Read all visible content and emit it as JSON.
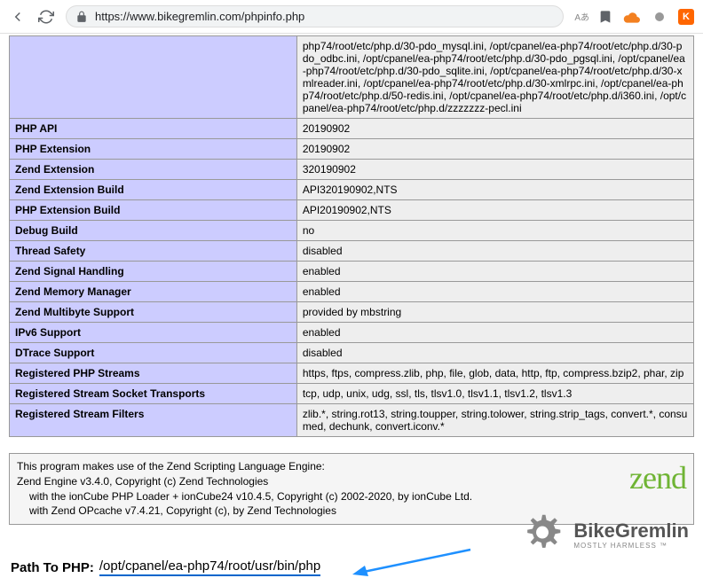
{
  "browser": {
    "url": "https://www.bikegremlin.com/phpinfo.php",
    "translate_label": "Aあ"
  },
  "php_rows": [
    {
      "label": "",
      "value": "php74/root/etc/php.d/30-pdo_mysql.ini, /opt/cpanel/ea-php74/root/etc/php.d/30-pdo_odbc.ini, /opt/cpanel/ea-php74/root/etc/php.d/30-pdo_pgsql.ini, /opt/cpanel/ea-php74/root/etc/php.d/30-pdo_sqlite.ini, /opt/cpanel/ea-php74/root/etc/php.d/30-xmlreader.ini, /opt/cpanel/ea-php74/root/etc/php.d/30-xmlrpc.ini, /opt/cpanel/ea-php74/root/etc/php.d/50-redis.ini, /opt/cpanel/ea-php74/root/etc/php.d/i360.ini, /opt/cpanel/ea-php74/root/etc/php.d/zzzzzzz-pecl.ini"
    },
    {
      "label": "PHP API",
      "value": "20190902"
    },
    {
      "label": "PHP Extension",
      "value": "20190902"
    },
    {
      "label": "Zend Extension",
      "value": "320190902"
    },
    {
      "label": "Zend Extension Build",
      "value": "API320190902,NTS"
    },
    {
      "label": "PHP Extension Build",
      "value": "API20190902,NTS"
    },
    {
      "label": "Debug Build",
      "value": "no"
    },
    {
      "label": "Thread Safety",
      "value": "disabled"
    },
    {
      "label": "Zend Signal Handling",
      "value": "enabled"
    },
    {
      "label": "Zend Memory Manager",
      "value": "enabled"
    },
    {
      "label": "Zend Multibyte Support",
      "value": "provided by mbstring"
    },
    {
      "label": "IPv6 Support",
      "value": "enabled"
    },
    {
      "label": "DTrace Support",
      "value": "disabled"
    },
    {
      "label": "Registered PHP Streams",
      "value": "https, ftps, compress.zlib, php, file, glob, data, http, ftp, compress.bzip2, phar, zip"
    },
    {
      "label": "Registered Stream Socket Transports",
      "value": "tcp, udp, unix, udg, ssl, tls, tlsv1.0, tlsv1.1, tlsv1.2, tlsv1.3"
    },
    {
      "label": "Registered Stream Filters",
      "value": "zlib.*, string.rot13, string.toupper, string.tolower, string.strip_tags, convert.*, consumed, dechunk, convert.iconv.*"
    }
  ],
  "zend": {
    "line1": "This program makes use of the Zend Scripting Language Engine:",
    "line2": "Zend Engine v3.4.0, Copyright (c) Zend Technologies",
    "line3": "with the ionCube PHP Loader + ionCube24 v10.4.5, Copyright (c) 2002-2020, by ionCube Ltd.",
    "line4": "with Zend OPcache v7.4.21, Copyright (c), by Zend Technologies",
    "logo": "zend"
  },
  "path": {
    "label": "Path To PHP:",
    "value": "/opt/cpanel/ea-php74/root/usr/bin/php"
  },
  "brand": {
    "main": "BikeGremlin",
    "sub": "MOSTLY HARMLESS ™"
  }
}
